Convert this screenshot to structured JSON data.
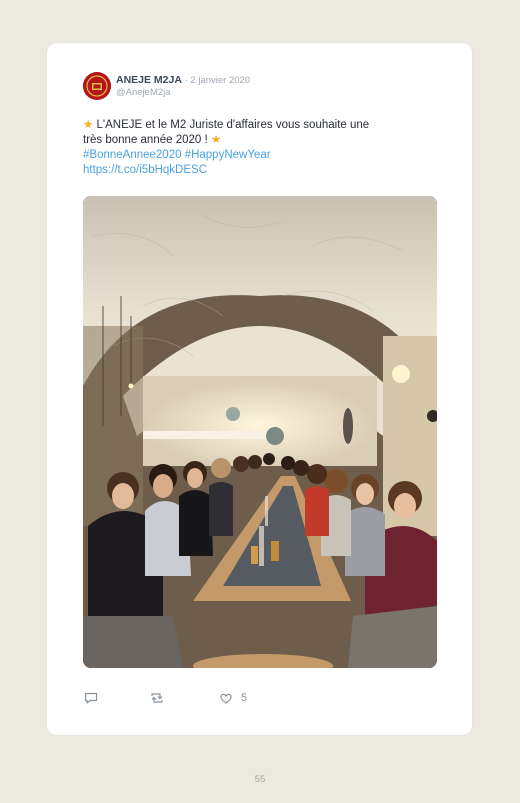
{
  "tweet": {
    "display_name": "ANEJE M2JA",
    "separator": " · ",
    "date": "2 janvier 2020",
    "handle": "@AnejeM2ja",
    "text_line1": " L'ANEJE et le M2 Juriste d'affaires vous souhaite une",
    "text_line2": "très bonne année 2020 ! ",
    "hashtags": "#BonneAnnee2020 #HappyNewYear",
    "link": "https://t.co/i5bHqkDESC",
    "star_glyph": "★",
    "like_count": "5"
  },
  "icons": {
    "reply": "reply-icon",
    "retweet": "retweet-icon",
    "like": "heart-icon",
    "star": "star-icon"
  },
  "colors": {
    "page_background": "#ece9e1",
    "card": "#ffffff",
    "link": "#4aa3df",
    "avatar": "#b3171c",
    "star": "#f2b01e"
  },
  "page_number": "55"
}
